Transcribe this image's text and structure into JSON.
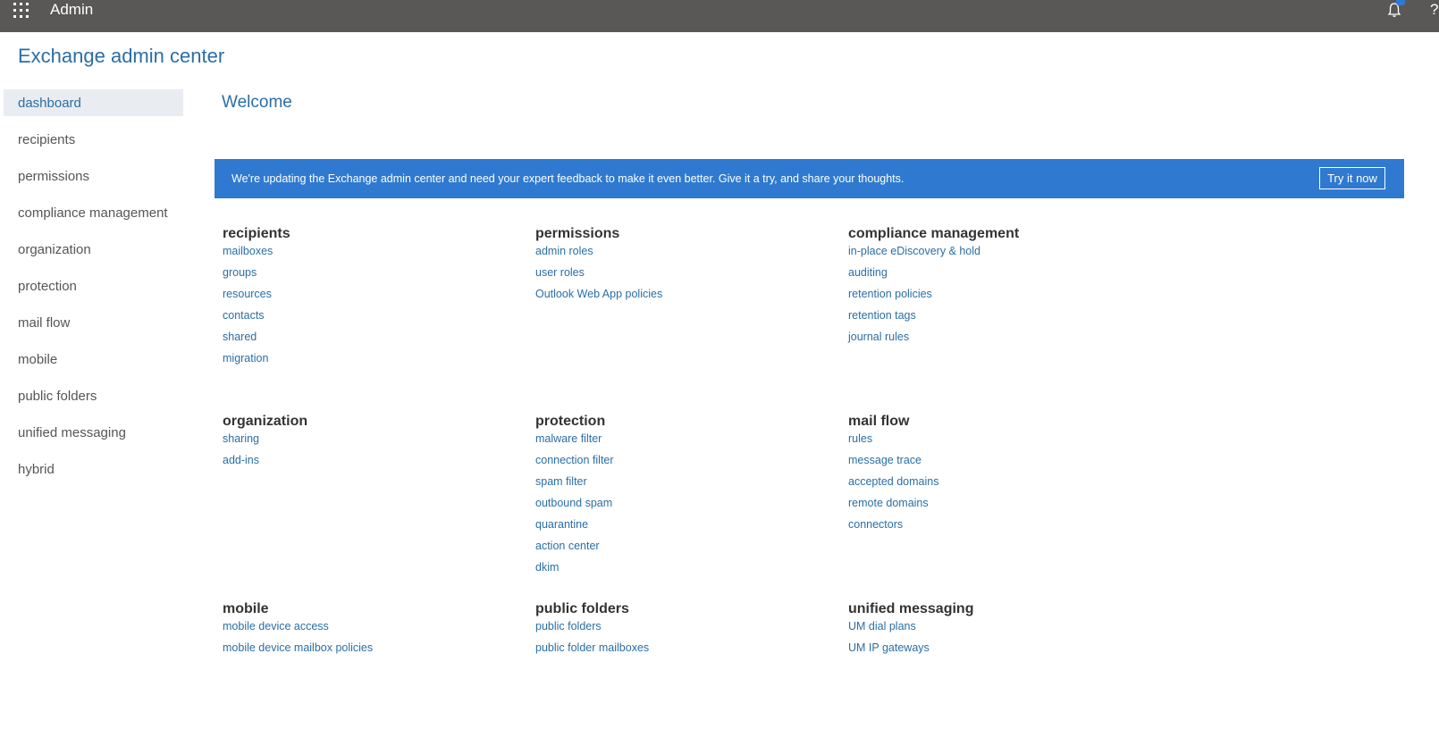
{
  "topbar": {
    "app_name": "Admin",
    "waffle_icon": "app-launcher-icon",
    "bell_icon": "notification-bell-icon",
    "help_label": "?"
  },
  "page_title": "Exchange admin center",
  "nav": {
    "items": [
      {
        "label": "dashboard",
        "active": true
      },
      {
        "label": "recipients"
      },
      {
        "label": "permissions"
      },
      {
        "label": "compliance management"
      },
      {
        "label": "organization"
      },
      {
        "label": "protection"
      },
      {
        "label": "mail flow"
      },
      {
        "label": "mobile"
      },
      {
        "label": "public folders"
      },
      {
        "label": "unified messaging"
      },
      {
        "label": "hybrid"
      }
    ]
  },
  "main": {
    "welcome": "Welcome",
    "banner": {
      "text": "We're updating the Exchange admin center and need your expert feedback to make it even better. Give it a try, and share your thoughts.",
      "button_label": "Try it now",
      "color": "#2f7ad0"
    },
    "sections": [
      {
        "title": "recipients",
        "links": [
          "mailboxes",
          "groups",
          "resources",
          "contacts",
          "shared",
          "migration"
        ]
      },
      {
        "title": "permissions",
        "links": [
          "admin roles",
          "user roles",
          "Outlook Web App policies"
        ]
      },
      {
        "title": "compliance management",
        "links": [
          "in-place eDiscovery & hold",
          "auditing",
          "retention policies",
          "retention tags",
          "journal rules"
        ]
      },
      {
        "title": "organization",
        "links": [
          "sharing",
          "add-ins"
        ]
      },
      {
        "title": "protection",
        "links": [
          "malware filter",
          "connection filter",
          "spam filter",
          "outbound spam",
          "quarantine",
          "action center",
          "dkim"
        ]
      },
      {
        "title": "mail flow",
        "links": [
          "rules",
          "message trace",
          "accepted domains",
          "remote domains",
          "connectors"
        ]
      },
      {
        "title": "mobile",
        "links": [
          "mobile device access",
          "mobile device mailbox policies"
        ]
      },
      {
        "title": "public folders",
        "links": [
          "public folders",
          "public folder mailboxes"
        ]
      },
      {
        "title": "unified messaging",
        "links": [
          "UM dial plans",
          "UM IP gateways"
        ]
      }
    ]
  }
}
